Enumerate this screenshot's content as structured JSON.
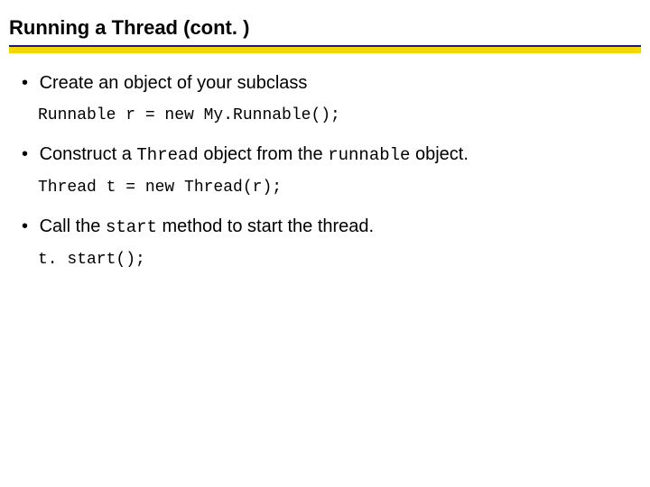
{
  "title": "Running a Thread  (cont. )",
  "bullets": [
    {
      "prefix": "Create an object of your subclass",
      "code": "Runnable r = new My.Runnable();"
    },
    {
      "prefix": "Construct a ",
      "mono1": "Thread",
      "mid": " object from the ",
      "mono2": "runnable",
      "suffix": " object.",
      "code": "Thread t = new Thread(r);"
    },
    {
      "prefix": "Call the ",
      "mono1": "start",
      "mid": " method to start the thread.",
      "code": "t. start();"
    }
  ],
  "bullet_char": "•"
}
